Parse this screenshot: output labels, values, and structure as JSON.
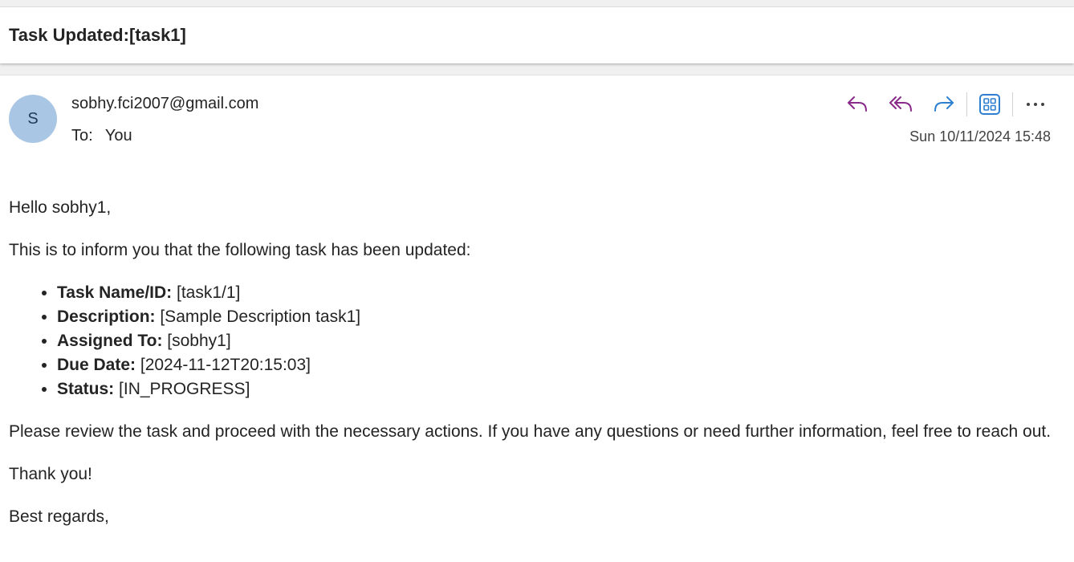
{
  "subject": "Task Updated:[task1]",
  "header": {
    "avatar_initial": "S",
    "sender": "sobhy.fci2007@gmail.com",
    "to_label": "To:",
    "to_value": "You",
    "date": "Sun 10/11/2024 15:48",
    "actions": [
      "reply-icon",
      "reply-all-icon",
      "forward-icon",
      "apps-icon",
      "more-icon"
    ],
    "colors": {
      "reply": "#8a2a8a",
      "forward": "#2f7fd0",
      "apps": "#2f7fd0",
      "avatar_bg": "#a9c6e4"
    }
  },
  "body": {
    "greeting": "Hello sobhy1,",
    "intro": "This is to inform you that the following task has been updated:",
    "details": [
      {
        "label": "Task Name/ID:",
        "value": " [task1/1]"
      },
      {
        "label": "Description:",
        "value": " [Sample Description task1]"
      },
      {
        "label": "Assigned To:",
        "value": " [sobhy1]"
      },
      {
        "label": "Due Date:",
        "value": " [2024-11-12T20:15:03]"
      },
      {
        "label": "Status:",
        "value": " [IN_PROGRESS]"
      }
    ],
    "request": "Please review the task and proceed with the necessary actions. If you have any questions or need further information, feel free to reach out.",
    "thanks": "Thank you!",
    "closing": "Best regards,"
  }
}
